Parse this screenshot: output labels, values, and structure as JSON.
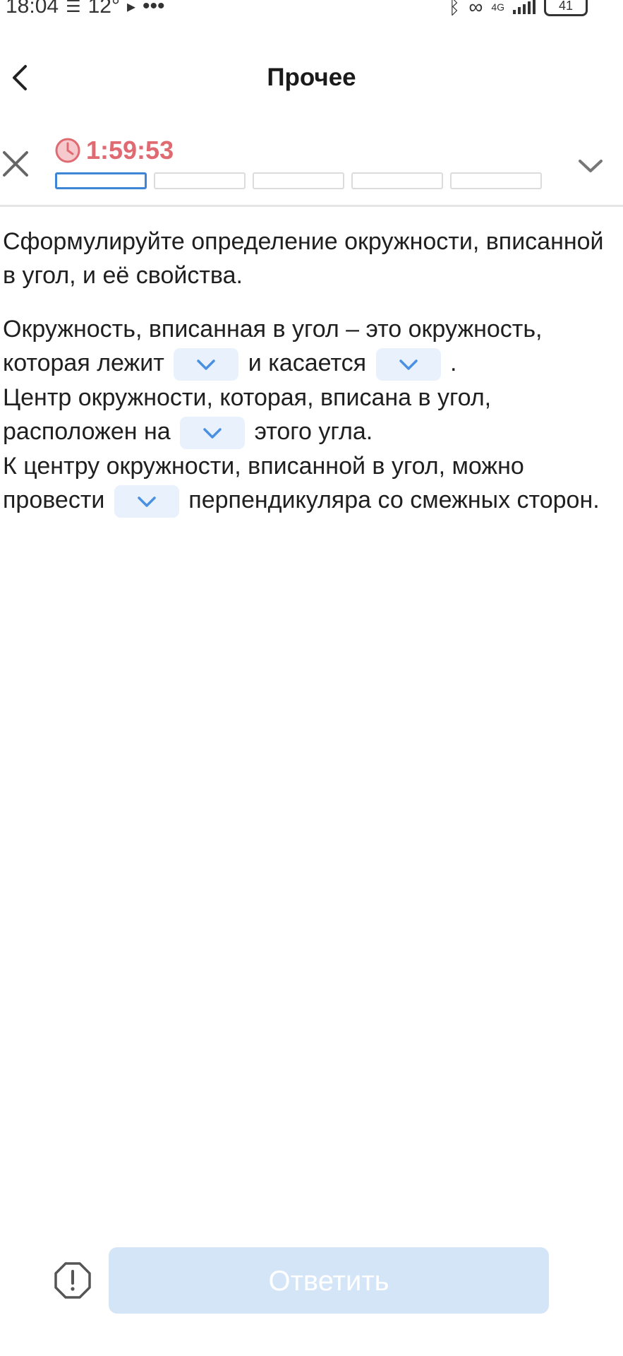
{
  "status_bar": {
    "time": "18:04",
    "temperature": "12°",
    "dots": "•••",
    "network": "4G",
    "battery": "41"
  },
  "header": {
    "title": "Прочее"
  },
  "timer": {
    "value": "1:59:53"
  },
  "progress": {
    "total_segments": 5,
    "active_segment": 1
  },
  "question": {
    "text": "Сформулируйте определение окружности, вписанной в угол, и её свойства."
  },
  "answer_text": {
    "s1_part1": "Окружность, вписанная в угол – это окружность, которая лежит",
    "s1_part2": "и касается",
    "s1_part3": ".",
    "s2_part1": "Центр окружности, которая, вписана в угол, расположен на",
    "s2_part2": "этого угла.",
    "s3_part1": "К центру окружности, вписанной в угол, можно провести",
    "s3_part2": "перпендикуляра со смежных сторон."
  },
  "footer": {
    "answer_label": "Ответить"
  },
  "colors": {
    "accent": "#3d86d6",
    "timer": "#e06a72",
    "dropdown_bg": "#e8f1fc",
    "button_disabled": "#d5e5f8"
  }
}
